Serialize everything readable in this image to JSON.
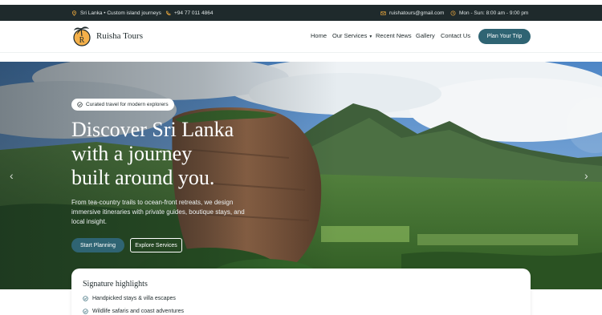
{
  "topbar": {
    "location": "Sri Lanka • Custom island journeys",
    "phone": "+94 77 011 4864",
    "email": "ruishatours@gmail.com",
    "hours": "Mon - Sun: 8:00 am - 9:00 pm"
  },
  "brand": {
    "name": "Ruisha Tours",
    "logo_letter": "R"
  },
  "nav": {
    "items": [
      "Home",
      "Our Services",
      "Recent News",
      "Gallery",
      "Contact Us"
    ],
    "cta": "Plan Your Trip"
  },
  "hero": {
    "tagline": "Curated travel for modern explorers",
    "headline_lines": [
      "Discover Sri Lanka",
      "with a journey",
      "built around you."
    ],
    "intro": "From tea-country trails to ocean-front retreats, we design immersive itineraries with private guides, boutique stays, and local insight.",
    "primary_button": "Start Planning",
    "secondary_button": "Explore Services",
    "prev_arrow": "‹",
    "next_arrow": "›"
  },
  "highlights": {
    "title": "Signature highlights",
    "items": [
      "Handpicked stays & villa escapes",
      "Wildlife safaris and coast adventures"
    ]
  },
  "colors": {
    "topbar_bg": "#1f2a2c",
    "accent": "#2f6473",
    "icon_accent": "#e0a13c"
  },
  "icons": {
    "location": "map-pin-icon",
    "phone": "phone-icon",
    "email": "mail-icon",
    "hours": "clock-icon",
    "check": "check-circle-icon",
    "dropdown": "chevron-down-icon"
  }
}
